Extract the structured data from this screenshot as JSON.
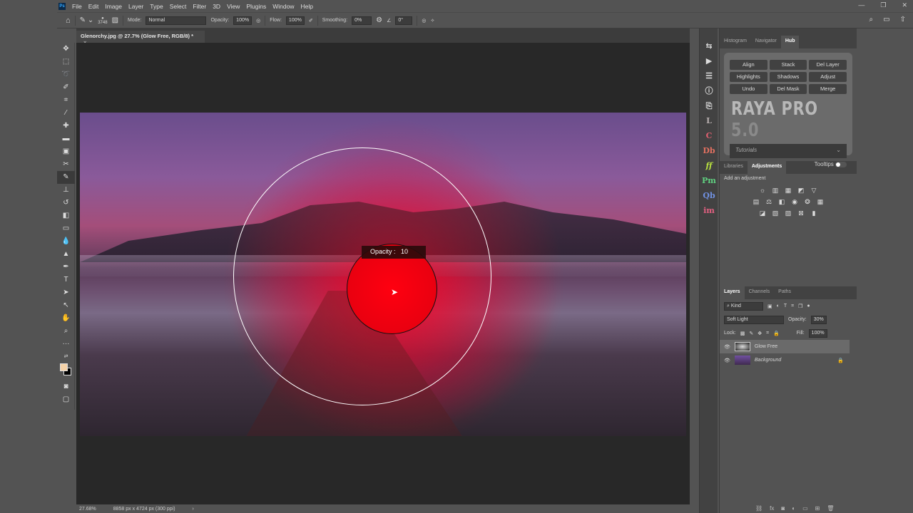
{
  "app": {
    "logo": "Ps"
  },
  "menu": [
    "File",
    "Edit",
    "Image",
    "Layer",
    "Type",
    "Select",
    "Filter",
    "3D",
    "View",
    "Plugins",
    "Window",
    "Help"
  ],
  "options": {
    "brush_size": "3748",
    "mode_label": "Mode:",
    "mode": "Normal",
    "opacity_label": "Opacity:",
    "opacity": "100%",
    "flow_label": "Flow:",
    "flow": "100%",
    "smoothing_label": "Smoothing:",
    "smoothing": "0%",
    "angle": "0°"
  },
  "document": {
    "tab_title": "Glenorchy.jpg @ 27.7% (Glow Free, RGB/8) *",
    "hud_label": "Opacity :",
    "hud_value": "10"
  },
  "status": {
    "zoom": "27.68%",
    "dimensions": "8858 px x 4724 px (300 ppi)"
  },
  "hub_panel": {
    "tabs": [
      "Histogram",
      "Navigator",
      "Hub"
    ],
    "buttons": [
      "Align",
      "Stack",
      "Del Layer",
      "Highlights",
      "Shadows",
      "Adjust",
      "Undo",
      "Del Mask",
      "Merge"
    ],
    "brand": "RAYA PRO",
    "version": "5.0",
    "dropdown": "Tutorials",
    "tooltips_label": "Tooltips"
  },
  "adjust_panel": {
    "tabs": [
      "Libraries",
      "Adjustments"
    ],
    "title": "Add an adjustment"
  },
  "layers_panel": {
    "tabs": [
      "Layers",
      "Channels",
      "Paths"
    ],
    "filter": "Kind",
    "blend_mode": "Soft Light",
    "opacity_label": "Opacity:",
    "opacity": "30%",
    "lock_label": "Lock:",
    "fill_label": "Fill:",
    "fill": "100%",
    "layers": [
      {
        "name": "Glow Free",
        "selected": true
      },
      {
        "name": "Background",
        "locked": true
      }
    ]
  },
  "dock_icons": [
    "L",
    "C",
    "Db",
    "ff",
    "Pm",
    "Qb",
    "im"
  ],
  "colors": {
    "accent": "#e00010",
    "panel": "#535353"
  }
}
